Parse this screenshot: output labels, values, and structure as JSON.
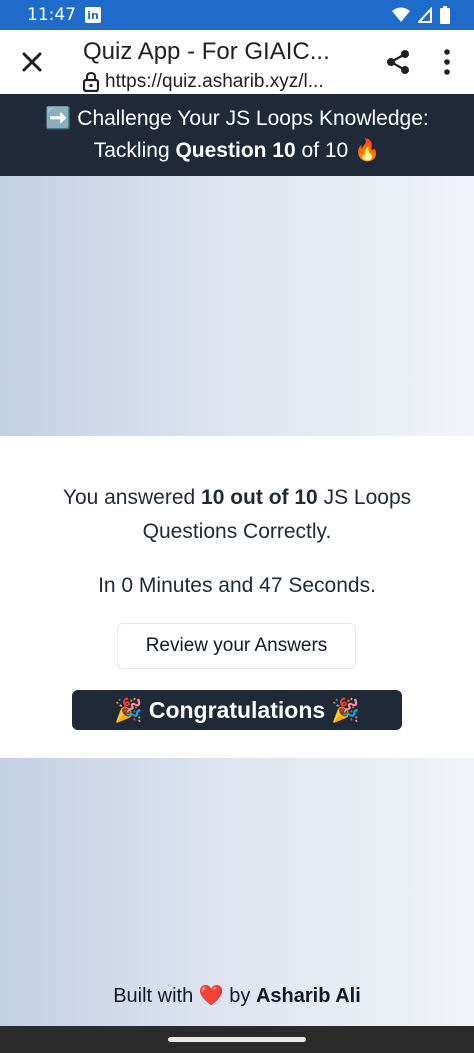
{
  "status_bar": {
    "time": "11:47",
    "app_icon": "linkedin-icon"
  },
  "browser": {
    "title": "Quiz App - For GIAIC...",
    "url": "https://quiz.asharib.xyz/l...",
    "icons": [
      "close-icon",
      "lock-icon",
      "share-icon",
      "more-vert-icon"
    ]
  },
  "banner": {
    "emoji_start": "➡️",
    "line1": "Challenge Your JS Loops Knowledge:",
    "line2_prefix": "Tackling",
    "question_label": "Question 10",
    "line2_suffix": "of 10",
    "emoji_end": "🔥"
  },
  "result": {
    "answered_prefix": "You answered",
    "score": "10 out of 10",
    "answered_suffix": "JS Loops",
    "answered_line2": "Questions Correctly.",
    "time_text": "In 0 Minutes and 47 Seconds.",
    "review_button": "Review your Answers",
    "congrats_label": "Congratulations",
    "congrats_emoji": "🎉"
  },
  "footer": {
    "built_with": "Built with",
    "heart": "❤️",
    "by": "by",
    "author": "Asharib Ali"
  },
  "colors": {
    "status_bar": "#1e6bc9",
    "banner_bg": "#1f2937",
    "gradient_start": "#c3cfe2",
    "gradient_end": "#f1f4f9"
  }
}
